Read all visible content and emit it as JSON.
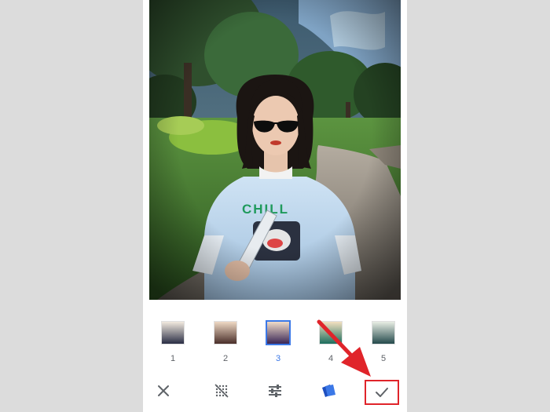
{
  "editor": {
    "presets": [
      {
        "label": "1",
        "top": "#f2eadf",
        "bottom": "#2a2e45",
        "selected": false
      },
      {
        "label": "2",
        "top": "#efd9c4",
        "bottom": "#4a2f2a",
        "selected": false
      },
      {
        "label": "3",
        "top": "#f0dcc8",
        "bottom": "#3a2656",
        "selected": true
      },
      {
        "label": "4",
        "top": "#f3e0c0",
        "bottom": "#1d6e5e",
        "selected": false
      },
      {
        "label": "5",
        "top": "#e8eee4",
        "bottom": "#244a4c",
        "selected": false
      }
    ],
    "toolbar": {
      "close_icon": "close-icon",
      "blend_icon": "dotted-grid-icon",
      "adjust_icon": "sliders-icon",
      "style_icon": "cards-icon",
      "confirm_icon": "checkmark-icon"
    },
    "colors": {
      "accent": "#3b78e7",
      "highlight": "#e0242a"
    }
  }
}
